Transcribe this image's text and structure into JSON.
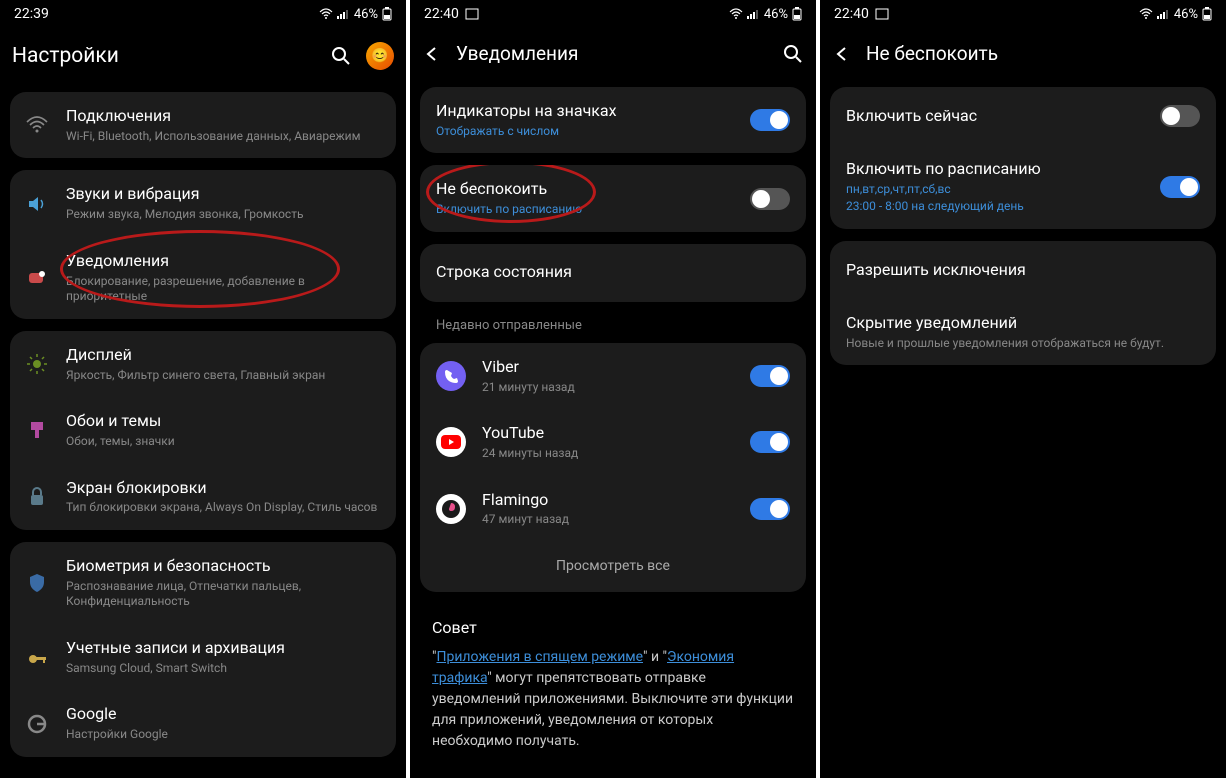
{
  "screen1": {
    "status": {
      "time": "22:39",
      "battery": "46%"
    },
    "title": "Настройки",
    "items": [
      {
        "label": "Подключения",
        "sub": "Wi-Fi, Bluetooth, Использование данных, Авиарежим"
      },
      {
        "label": "Звуки и вибрация",
        "sub": "Режим звука, Мелодия звонка, Громкость"
      },
      {
        "label": "Уведомления",
        "sub": "Блокирование, разрешение, добавление в приоритетные"
      },
      {
        "label": "Дисплей",
        "sub": "Яркость, Фильтр синего света, Главный экран"
      },
      {
        "label": "Обои и темы",
        "sub": "Обои, темы, значки"
      },
      {
        "label": "Экран блокировки",
        "sub": "Тип блокировки экрана, Always On Display, Стиль часов"
      },
      {
        "label": "Биометрия и безопасность",
        "sub": "Распознавание лица, Отпечатки пальцев, Конфиденциальность"
      },
      {
        "label": "Учетные записи и архивация",
        "sub": "Samsung Cloud, Smart Switch"
      },
      {
        "label": "Google",
        "sub": "Настройки Google"
      }
    ]
  },
  "screen2": {
    "status": {
      "time": "22:40",
      "battery": "46%"
    },
    "title": "Уведомления",
    "indicators": {
      "label": "Индикаторы на значках",
      "sub": "Отображать с числом"
    },
    "dnd": {
      "label": "Не беспокоить",
      "sub": "Включить по расписанию"
    },
    "statusbar": {
      "label": "Строка состояния"
    },
    "recent_hdr": "Недавно отправленные",
    "apps": [
      {
        "name": "Viber",
        "sub": "21 минуту назад"
      },
      {
        "name": "YouTube",
        "sub": "24 минуты назад"
      },
      {
        "name": "Flamingo",
        "sub": "47 минут назад"
      }
    ],
    "view_all": "Просмотреть все",
    "tip_title": "Совет",
    "tip_link1": "Приложения в спящем режиме",
    "tip_mid1": "\" и \"",
    "tip_link2": "Экономия трафика",
    "tip_body_rest": "\" могут препятствовать отправке уведомлений приложениями. Выключите эти функции для приложений, уведомления от которых необходимо получать."
  },
  "screen3": {
    "status": {
      "time": "22:40",
      "battery": "46%"
    },
    "title": "Не беспокоить",
    "enable_now": "Включить сейчас",
    "schedule": {
      "label": "Включить по расписанию",
      "days": "пн,вт,ср,чт,пт,сб,вс",
      "time": "23:00 - 8:00 на следующий день"
    },
    "exceptions": "Разрешить исключения",
    "hide": {
      "label": "Скрытие уведомлений",
      "sub": "Новые и прошлые уведомления отображаться не будут."
    }
  }
}
